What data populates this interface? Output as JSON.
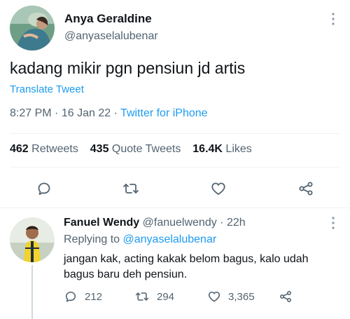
{
  "tweet": {
    "author_name": "Anya Geraldine",
    "author_handle": "@anyaselalubenar",
    "text": "kadang mikir pgn pensiun jd artis",
    "translate_label": "Translate Tweet",
    "time": "8:27 PM",
    "date": "16 Jan 22",
    "source": "Twitter for iPhone",
    "separator": "·",
    "stats": {
      "retweets_count": "462",
      "retweets_label": "Retweets",
      "quote_count": "435",
      "quote_label": "Quote Tweets",
      "likes_count": "16.4K",
      "likes_label": "Likes"
    },
    "icons": [
      "reply-icon",
      "retweet-icon",
      "like-icon",
      "share-icon"
    ]
  },
  "reply": {
    "author_name": "Fanuel Wendy",
    "author_handle": "@fanuelwendy",
    "age": "22h",
    "separator": "·",
    "replying_to_label": "Replying to",
    "replying_to_handle": "@anyaselalubenar",
    "text_line1": "jangan kak, acting kakak belom bagus, kalo udah",
    "text_line2": "bagus baru deh pensiun.",
    "reply_count": "212",
    "retweet_count": "294",
    "like_count": "3,365"
  },
  "colors": {
    "accent": "#1d9bf0",
    "text": "#0f1419",
    "muted": "#536471",
    "divider": "#eff3f4"
  }
}
